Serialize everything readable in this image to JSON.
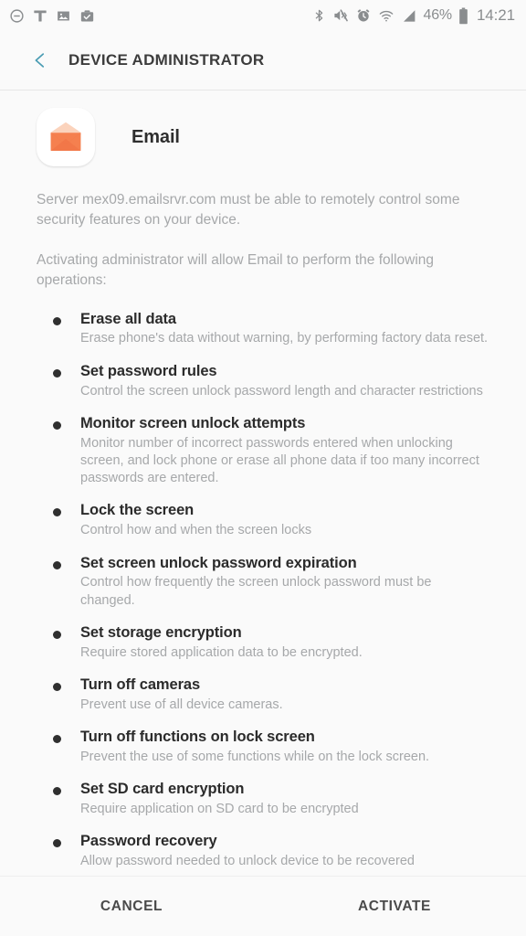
{
  "status_bar": {
    "left_icons": [
      {
        "name": "do-not-disturb-icon",
        "label": "Do not disturb"
      },
      {
        "name": "carrier-tmobile-icon",
        "label": "T-Mobile"
      },
      {
        "name": "image-icon",
        "label": "Screenshot captured"
      },
      {
        "name": "work-profile-icon",
        "label": "Work profile"
      }
    ],
    "right_icons": [
      {
        "name": "bluetooth-icon",
        "label": "Bluetooth"
      },
      {
        "name": "mute-vibrate-icon",
        "label": "Sound off"
      },
      {
        "name": "alarm-icon",
        "label": "Alarm set"
      },
      {
        "name": "wifi-icon",
        "label": "Wi-Fi"
      },
      {
        "name": "cellular-signal-icon",
        "label": "Cellular signal"
      }
    ],
    "battery_percent": "46%",
    "battery_icon": "battery-icon",
    "clock": "14:21"
  },
  "app_bar": {
    "back_icon": "back-chevron-icon",
    "back_icon_color": "#4a9cb3",
    "title": "DEVICE ADMINISTRATOR"
  },
  "app": {
    "icon_name": "email-app-icon",
    "icon_colors": {
      "envelope_body": "#f5804f",
      "envelope_body_dark": "#ef7043",
      "envelope_flap": "#fbd3bc",
      "tile_background": "#ffffff"
    },
    "name": "Email"
  },
  "description": {
    "server_notice": "Server mex09.emailsrvr.com must be able to remotely control some security features on your device.",
    "activation_notice": "Activating administrator will allow Email to perform the following operations:"
  },
  "operations": [
    {
      "title": "Erase all data",
      "description": "Erase phone's data without warning, by performing factory data reset."
    },
    {
      "title": "Set password rules",
      "description": "Control the screen unlock password length and character restrictions"
    },
    {
      "title": "Monitor screen unlock attempts",
      "description": "Monitor number of incorrect passwords entered when unlocking screen, and lock phone or erase all phone data if too many incorrect passwords are entered."
    },
    {
      "title": "Lock the screen",
      "description": "Control how and when the screen locks"
    },
    {
      "title": "Set screen unlock password expiration",
      "description": "Control how frequently the screen unlock password must be changed."
    },
    {
      "title": "Set storage encryption",
      "description": "Require stored application data to be encrypted."
    },
    {
      "title": "Turn off cameras",
      "description": "Prevent use of all device cameras."
    },
    {
      "title": "Turn off functions on lock screen",
      "description": "Prevent the use of some functions while on the lock screen."
    },
    {
      "title": "Set SD card encryption",
      "description": "Require application on SD card to be encrypted"
    },
    {
      "title": "Password recovery",
      "description": "Allow password needed to unlock device to be recovered"
    }
  ],
  "footer": {
    "cancel_label": "CANCEL",
    "activate_label": "ACTIVATE"
  },
  "theme": {
    "background": "#fafafa",
    "primary_text": "#2b2b2b",
    "secondary_text": "#a6a8aa",
    "accent": "#4a9cb3",
    "divider": "#e6e6e6"
  }
}
